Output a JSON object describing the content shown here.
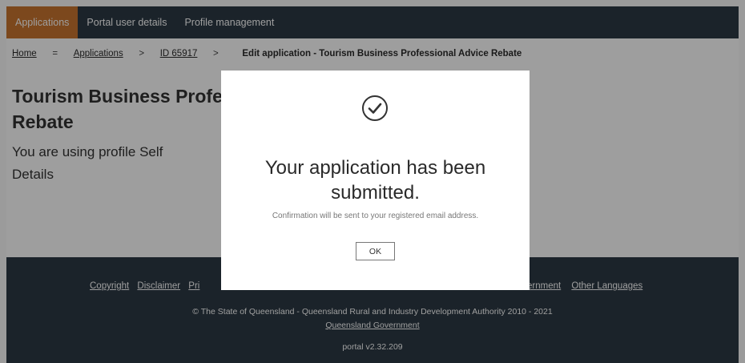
{
  "nav": {
    "tabs": [
      {
        "label": "Applications",
        "active": true
      },
      {
        "label": "Portal user details",
        "active": false
      },
      {
        "label": "Profile management",
        "active": false
      }
    ]
  },
  "breadcrumb": {
    "home": "Home",
    "applications": "Applications",
    "id": "ID 65917",
    "current": "Edit application - Tourism Business Professional Advice Rebate",
    "sep1": "=",
    "sep2": ">",
    "sep3": ">"
  },
  "main": {
    "title_line1": "Tourism Business Profe",
    "title_line2": "Rebate",
    "profile_text": "You are using profile Self",
    "details_heading": "Details"
  },
  "footer": {
    "links_left": [
      "Copyright",
      "Disclaimer",
      "Pri"
    ],
    "links_right": [
      "ernment",
      "Other Languages"
    ],
    "copyright": "© The State of Queensland - Queensland Rural and Industry Development Authority 2010 - 2021",
    "qgov_link": "Queensland Government",
    "version": "portal v2.32.209"
  },
  "modal": {
    "heading": "Your application has been submitted.",
    "message": "Confirmation will be sent to your registered email address.",
    "ok_label": "OK",
    "icon": "check-circle-icon"
  },
  "colors": {
    "nav_bg": "#2c3944",
    "active_tab": "#c8752f",
    "footer_bg": "#2c3944"
  }
}
